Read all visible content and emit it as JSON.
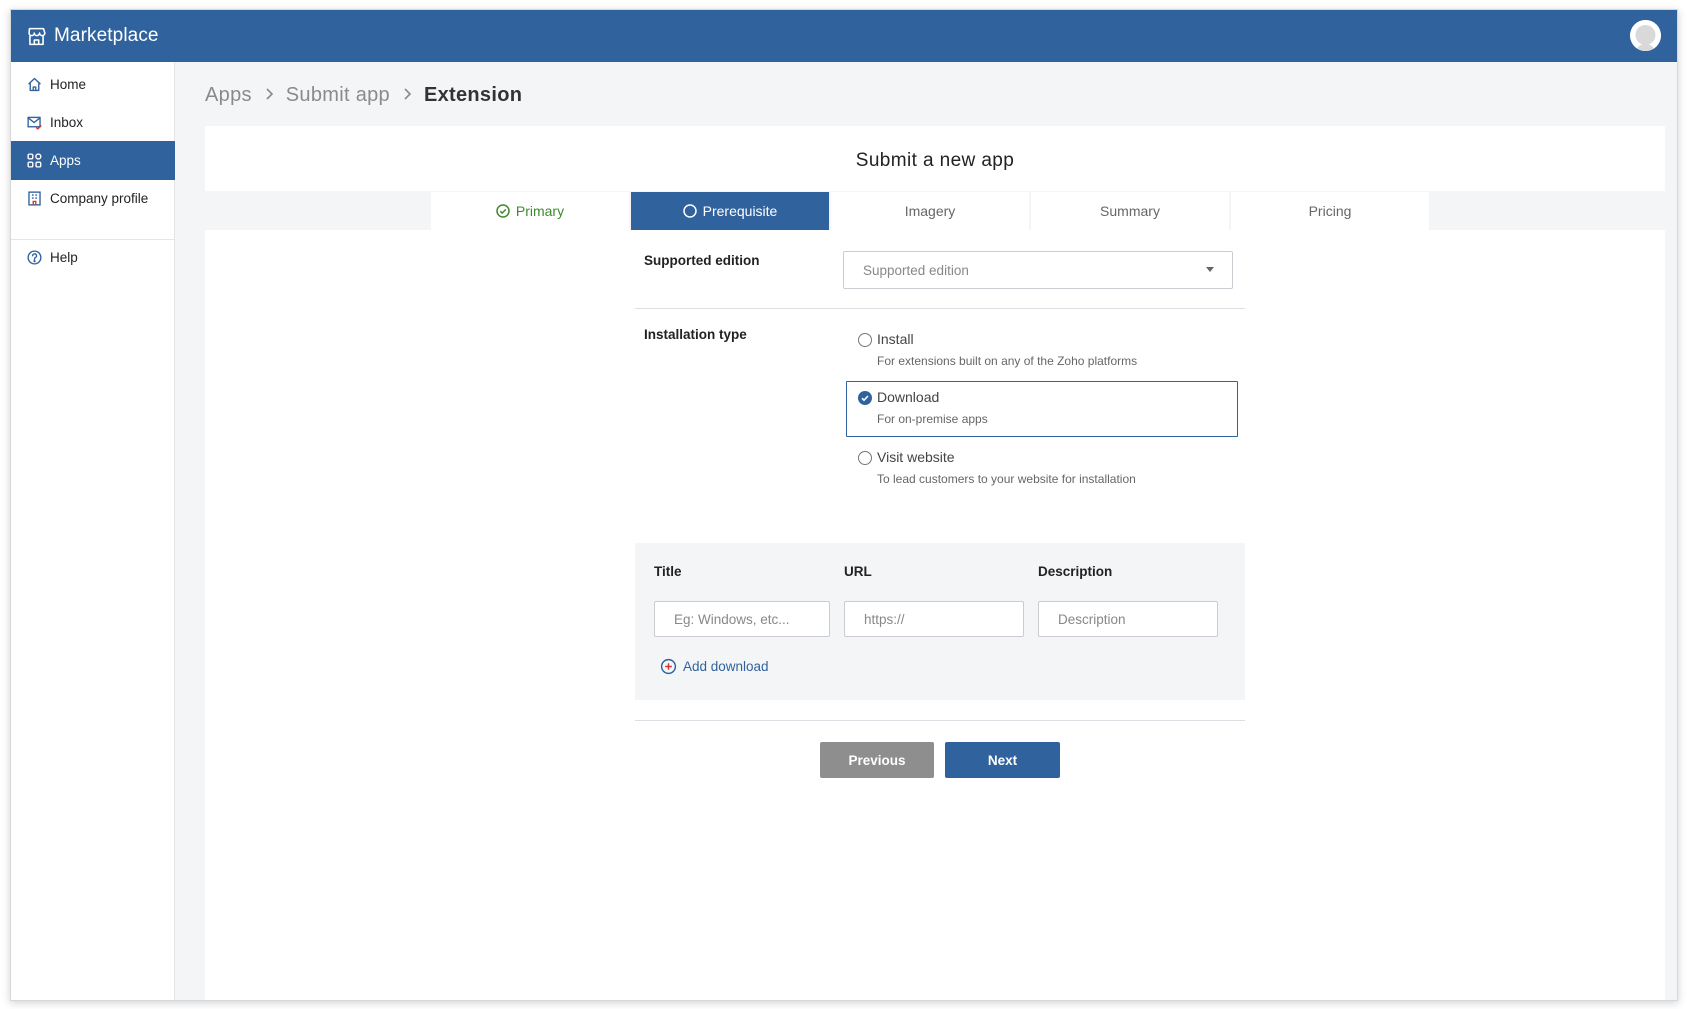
{
  "app": {
    "title": "Marketplace"
  },
  "sidebar": {
    "items": [
      {
        "label": "Home",
        "icon": "home-icon",
        "active": false
      },
      {
        "label": "Inbox",
        "icon": "inbox-icon",
        "active": false
      },
      {
        "label": "Apps",
        "icon": "apps-grid-icon",
        "active": true
      },
      {
        "label": "Company profile",
        "icon": "building-icon",
        "active": false
      },
      {
        "label": "Help",
        "icon": "help-icon",
        "active": false
      }
    ]
  },
  "breadcrumb": [
    "Apps",
    "Submit app",
    "Extension"
  ],
  "page": {
    "title": "Submit a new app",
    "tabs": [
      {
        "label": "Primary",
        "state": "completed"
      },
      {
        "label": "Prerequisite",
        "state": "active"
      },
      {
        "label": "Imagery",
        "state": "pending"
      },
      {
        "label": "Summary",
        "state": "pending"
      },
      {
        "label": "Pricing",
        "state": "pending"
      }
    ]
  },
  "form": {
    "supported_edition": {
      "label": "Supported edition",
      "placeholder": "Supported edition"
    },
    "installation_type": {
      "label": "Installation type",
      "selected": "Download",
      "options": [
        {
          "title": "Install",
          "description": "For extensions built on any of the Zoho platforms"
        },
        {
          "title": "Download",
          "description": "For on-premise apps"
        },
        {
          "title": "Visit website",
          "description": "To lead customers to your website for installation"
        }
      ]
    },
    "downloads": {
      "columns": {
        "title": "Title",
        "url": "URL",
        "description": "Description"
      },
      "placeholders": {
        "title": "Eg: Windows, etc...",
        "url": "https://",
        "description": "Description"
      },
      "add_label": "Add download"
    }
  },
  "actions": {
    "previous": "Previous",
    "next": "Next"
  },
  "colors": {
    "primary": "#30629d",
    "success": "#3f8a2f",
    "secondary_button": "#8e8e8e",
    "background": "#f4f5f7"
  }
}
